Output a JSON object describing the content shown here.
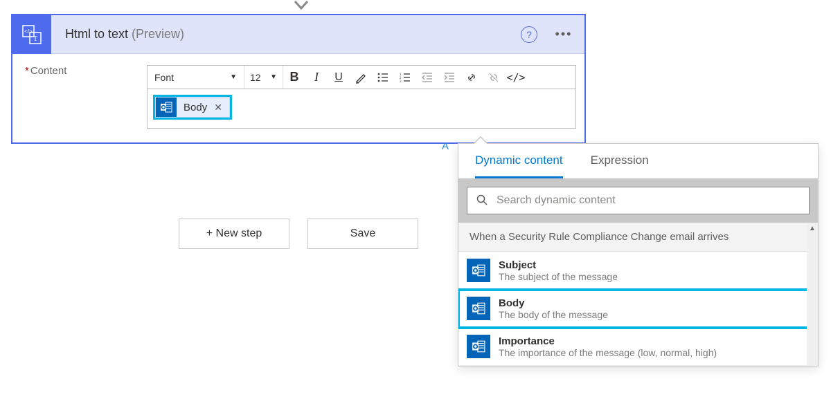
{
  "card": {
    "title": "Html to text",
    "preview": "(Preview)"
  },
  "form": {
    "content_label": "Content",
    "required_mark": "*"
  },
  "toolbar": {
    "font_label": "Font",
    "size_label": "12"
  },
  "token": {
    "label": "Body"
  },
  "actions": {
    "new_step": "+ New step",
    "save": "Save"
  },
  "hint_partial": "A",
  "dc": {
    "tabs": {
      "dynamic": "Dynamic content",
      "expression": "Expression"
    },
    "search_placeholder": "Search dynamic content",
    "group_title": "When a Security Rule Compliance Change email arrives",
    "items": [
      {
        "name": "Subject",
        "desc": "The subject of the message",
        "highlight": false
      },
      {
        "name": "Body",
        "desc": "The body of the message",
        "highlight": true
      },
      {
        "name": "Importance",
        "desc": "The importance of the message (low, normal, high)",
        "highlight": false
      }
    ]
  },
  "colors": {
    "accent": "#4f6bed",
    "highlight": "#00b7e4",
    "link": "#0078d4",
    "outlook": "#0364b8"
  }
}
